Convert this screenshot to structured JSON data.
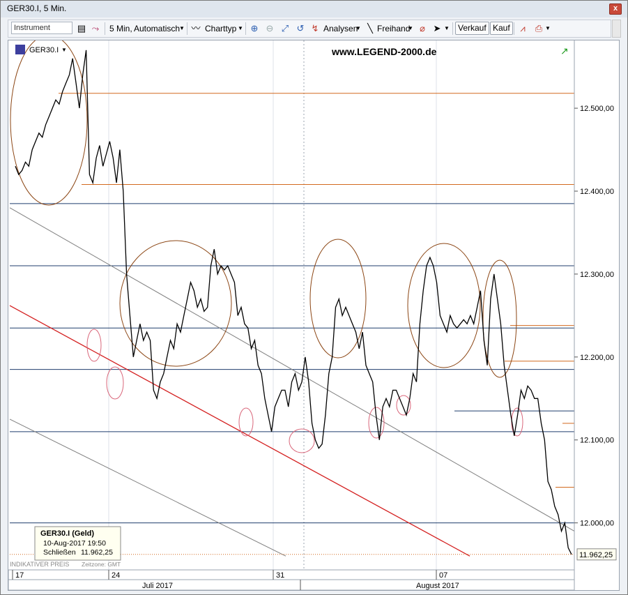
{
  "window": {
    "title": "GER30.I, 5 Min.",
    "close_label": "x"
  },
  "toolbar": {
    "instrument_placeholder": "Instrument",
    "interval_label": "5 Min,",
    "interval_mode": "Automatisch",
    "charttype_label": "Charttyp",
    "analyses_label": "Analysen",
    "freehand_label": "Freihand",
    "sell_label": "Verkauf",
    "buy_label": "Kauf"
  },
  "chart_header": {
    "symbol": "GER30.I",
    "watermark": "www.LEGEND-2000.de"
  },
  "info_box": {
    "title": "GER30.I (Geld)",
    "datetime": "10-Aug-2017 19:50",
    "close_label": "Schließen",
    "close_value": "11.962,25"
  },
  "footer_text": {
    "indicative": "INDIKATIVER PREIS",
    "timezone": "Zeitzone: GMT"
  },
  "colors": {
    "price": "#000000",
    "horizontal_blue": "#1f3d6d",
    "horizontal_orange": "#d2691e",
    "trend_red": "#d42020",
    "trend_gray": "#7f7f7f",
    "circles": "#8b4513",
    "small_circles": "#d9667a"
  },
  "chart_data": {
    "type": "line",
    "x_ticks": [
      "17",
      "24",
      "31",
      "07"
    ],
    "x_months": [
      "Juli 2017",
      "August 2017"
    ],
    "y_ticks": [
      "12.500,00",
      "12.400,00",
      "12.300,00",
      "12.200,00",
      "12.100,00",
      "12.000,00"
    ],
    "ylim": [
      11945,
      12580
    ],
    "current_price_label": "11.962,25",
    "series": [
      {
        "values": [
          12430,
          12420,
          12425,
          12435,
          12430,
          12450,
          12460,
          12470,
          12465,
          12480,
          12490,
          12500,
          12510,
          12505,
          12520,
          12530,
          12540,
          12560,
          12530,
          12500,
          12540,
          12570,
          12420,
          12410,
          12440,
          12455,
          12430,
          12445,
          12460,
          12440,
          12410,
          12450,
          12400,
          12300,
          12250,
          12200,
          12220,
          12240,
          12220,
          12230,
          12220,
          12160,
          12150,
          12170,
          12180,
          12200,
          12220,
          12210,
          12240,
          12230,
          12250,
          12270,
          12290,
          12280,
          12260,
          12270,
          12255,
          12260,
          12310,
          12330,
          12300,
          12310,
          12305,
          12310,
          12300,
          12290,
          12250,
          12260,
          12240,
          12235,
          12210,
          12220,
          12190,
          12180,
          12150,
          12130,
          12110,
          12140,
          12150,
          12160,
          12160,
          12140,
          12170,
          12180,
          12160,
          12170,
          12200,
          12170,
          12120,
          12100,
          12090,
          12095,
          12130,
          12180,
          12200,
          12260,
          12270,
          12250,
          12260,
          12250,
          12240,
          12230,
          12210,
          12230,
          12190,
          12180,
          12170,
          12130,
          12100,
          12140,
          12150,
          12140,
          12160,
          12160,
          12150,
          12140,
          12130,
          12150,
          12180,
          12170,
          12240,
          12280,
          12310,
          12320,
          12310,
          12290,
          12250,
          12240,
          12230,
          12250,
          12240,
          12235,
          12240,
          12245,
          12240,
          12250,
          12240,
          12260,
          12280,
          12220,
          12190,
          12270,
          12300,
          12270,
          12240,
          12190,
          12160,
          12130,
          12105,
          12130,
          12160,
          12150,
          12165,
          12160,
          12150,
          12150,
          12120,
          12100,
          12050,
          12040,
          12020,
          12010,
          11990,
          12000,
          11970,
          11962
        ]
      }
    ]
  }
}
